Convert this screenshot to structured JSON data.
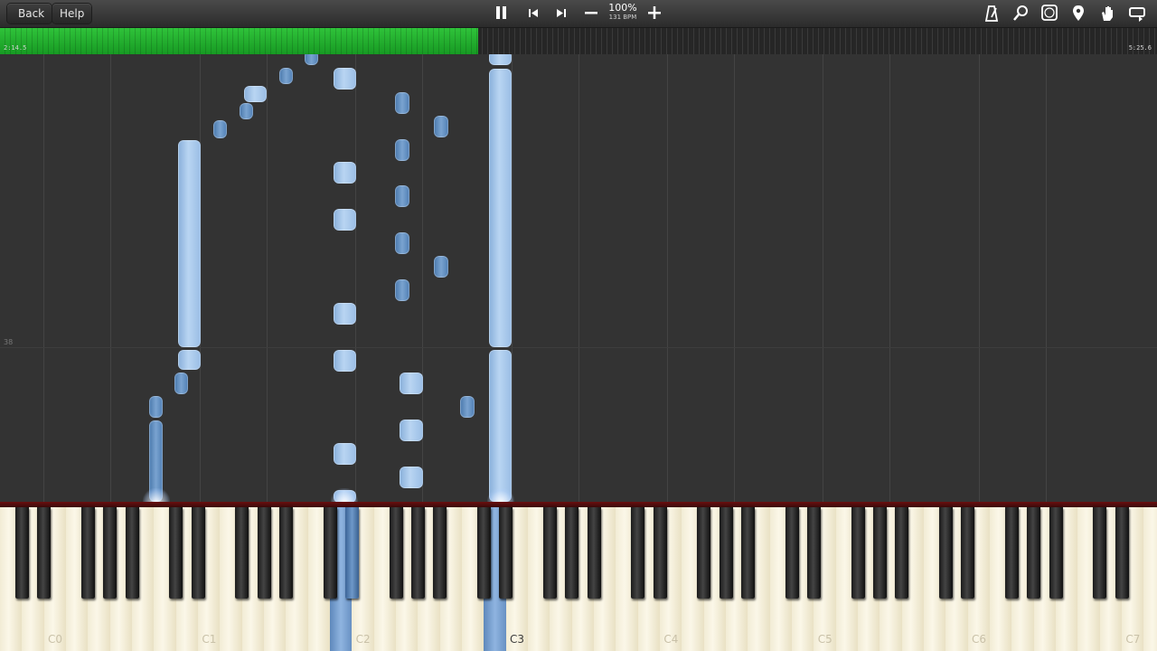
{
  "toolbar": {
    "back_label": "Back",
    "help_label": "Help",
    "zoom_percent": "100%",
    "tempo": "131 BPM",
    "icons": [
      "pause-icon",
      "previous-icon",
      "next-icon",
      "zoom-out-icon",
      "zoom-in-icon",
      "metronome-icon",
      "search-icon",
      "label-icon",
      "marker-icon",
      "hand-icon",
      "loop-icon"
    ]
  },
  "progress": {
    "current_time": "2:14.5",
    "total_time": "5:25.6",
    "fraction": 0.413,
    "fill_color": "#22b02e"
  },
  "staff": {
    "measure_number": "38"
  },
  "keyboard": {
    "octave_labels": [
      "C0",
      "C1",
      "C2",
      "C3",
      "C4",
      "C5",
      "C6",
      "C7"
    ],
    "active_label": "C3",
    "note_color": "#9cbfe6"
  }
}
